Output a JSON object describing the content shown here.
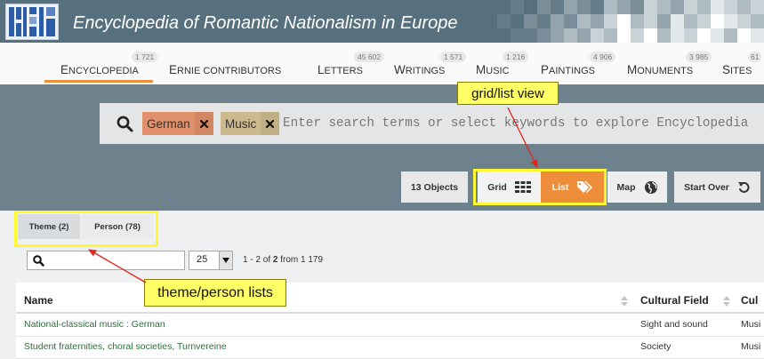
{
  "header": {
    "title": "Encyclopedia of Romantic Nationalism in Europe",
    "logo_icon": "ernie-logo-icon"
  },
  "nav": {
    "items": [
      {
        "label": "ENCYCLOPEDIA",
        "count": "1 721",
        "active": true
      },
      {
        "label": "ERNIE CONTRIBUTORS"
      },
      {
        "label": "LETTERS",
        "count": "45 602"
      },
      {
        "label": "WRITINGS",
        "count": "1 571"
      },
      {
        "label": "MUSIC",
        "count": "1 216"
      },
      {
        "label": "PAINTINGS",
        "count": "4 906"
      },
      {
        "label": "MONUMENTS",
        "count": "3 985"
      },
      {
        "label": "SITES",
        "count": "61"
      }
    ]
  },
  "search": {
    "icon": "search-icon",
    "placeholder": "Enter search terms or select keywords to explore Encyclopedia",
    "tags": [
      {
        "label": "German",
        "remove_icon": "close-icon",
        "color": "#e0906a"
      },
      {
        "label": "Music",
        "remove_icon": "close-icon",
        "color": "#cdb98e"
      }
    ]
  },
  "view": {
    "objects_label": "13 Objects",
    "grid_label": "Grid",
    "grid_icon": "grid-icon",
    "list_label": "List",
    "list_icon": "tag-icon",
    "list_active": true,
    "map_label": "Map",
    "map_icon": "globe-icon",
    "start_over_label": "Start Over",
    "start_over_icon": "reset-icon"
  },
  "facet_tabs": [
    {
      "label": "Theme (2)",
      "active": true
    },
    {
      "label": "Person (78)",
      "active": false
    }
  ],
  "list_controls": {
    "search_icon": "search-icon",
    "page_size": "25",
    "range_prefix": "1 - 2 of ",
    "range_total": "2",
    "range_suffix": " from 1 179"
  },
  "table": {
    "columns": [
      "Name",
      "Cultural Field",
      "Cul"
    ],
    "sort_icon": "sort-icon",
    "rows": [
      {
        "name": "National-classical music : German",
        "cultural_field": "Sight and sound",
        "third": "Musi"
      },
      {
        "name": "Student fraternities, choral societies, Turnvereine",
        "cultural_field": "Society",
        "third": "Musi"
      }
    ]
  },
  "annotations": [
    "grid/list view",
    "theme/person lists"
  ],
  "colors": {
    "header": "#57707e",
    "band": "#6e828d",
    "accent": "#ef8e3a",
    "link": "#2e6e3a",
    "callout": "#ffff66",
    "highlight": "#fff833",
    "arrow": "#e3241b"
  }
}
